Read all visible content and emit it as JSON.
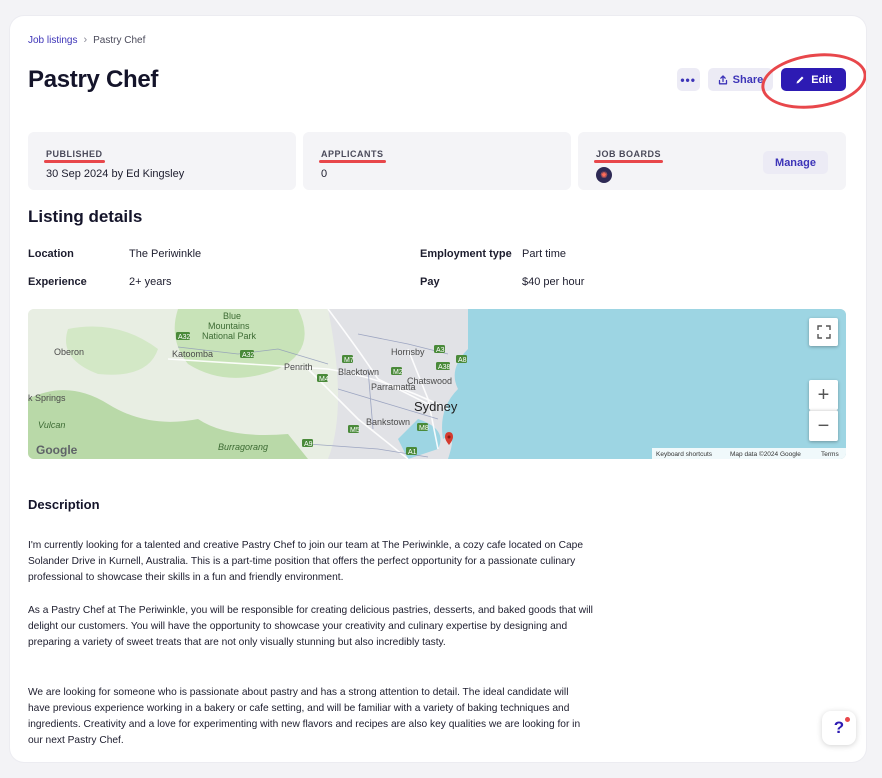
{
  "breadcrumb": {
    "parent": "Job listings",
    "current": "Pastry Chef"
  },
  "page": {
    "title": "Pastry Chef"
  },
  "actions": {
    "more": "•••",
    "share": "Share",
    "edit": "Edit"
  },
  "stats": {
    "published": {
      "label": "PUBLISHED",
      "value": "30 Sep 2024 by Ed Kingsley"
    },
    "applicants": {
      "label": "APPLICANTS",
      "value": "0"
    },
    "job_boards": {
      "label": "JOB BOARDS",
      "manage": "Manage"
    }
  },
  "listing": {
    "title": "Listing details",
    "location": {
      "label": "Location",
      "value": "The Periwinkle"
    },
    "experience": {
      "label": "Experience",
      "value": "2+ years"
    },
    "employment_type": {
      "label": "Employment type",
      "value": "Part time"
    },
    "pay": {
      "label": "Pay",
      "value": "$40 per hour"
    }
  },
  "map": {
    "places": [
      "Blue",
      "Mountains",
      "National Park",
      "Oberon",
      "Katoomba",
      "Penrith",
      "Blacktown",
      "Hornsby",
      "Parramatta",
      "Chatswood",
      "Sydney",
      "Bankstown",
      "Burragorang",
      "Vulcan",
      "k Springs"
    ],
    "roads": [
      "A32",
      "A32",
      "M7",
      "M4",
      "A3",
      "A28",
      "A8",
      "M2",
      "M8",
      "A9",
      "M5",
      "A1"
    ],
    "logo": "Google",
    "footer": {
      "shortcuts": "Keyboard shortcuts",
      "data": "Map data ©2024 Google",
      "terms": "Terms"
    },
    "zoom_in": "+",
    "zoom_out": "−"
  },
  "description": {
    "title": "Description",
    "p1": "I'm currently looking for a talented and creative Pastry Chef to join our team at The Periwinkle, a cozy cafe located on Cape Solander Drive in Kurnell, Australia. This is a part-time position that offers the perfect opportunity for a passionate culinary professional to showcase their skills in a fun and friendly environment.",
    "p2": "As a Pastry Chef at The Periwinkle, you will be responsible for creating delicious pastries, desserts, and baked goods that will delight our customers. You will have the opportunity to showcase your creativity and culinary expertise by designing and preparing a variety of sweet treats that are not only visually stunning but also incredibly tasty.",
    "p3": "We are looking for someone who is passionate about pastry and has a strong attention to detail. The ideal candidate will have previous experience working in a bakery or cafe setting, and will be familiar with a variety of baking techniques and ingredients. Creativity and a love for experimenting with new flavors and recipes are also key qualities we are looking for in our next Pastry Chef."
  },
  "help": {
    "label": "?"
  },
  "colors": {
    "accent": "#2d1bb3",
    "annotation": "#e8474b",
    "water": "#9dd5e3"
  }
}
